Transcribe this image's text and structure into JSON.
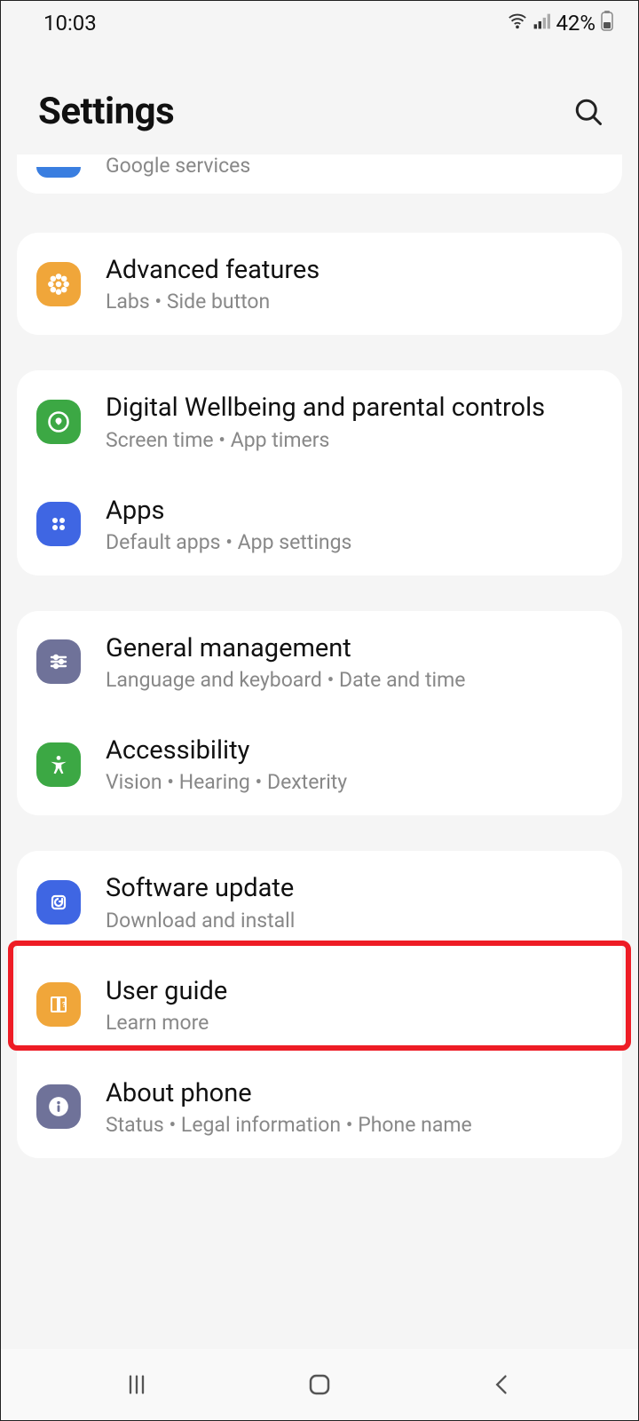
{
  "status": {
    "time": "10:03",
    "battery_text": "42%"
  },
  "header": {
    "title": "Settings"
  },
  "partial": {
    "sub": "Google services"
  },
  "g1": {
    "advanced": {
      "title": "Advanced features",
      "sub": "Labs  •  Side button",
      "color": "#f0a63a"
    }
  },
  "g2": {
    "dw": {
      "title": "Digital Wellbeing and parental controls",
      "sub": "Screen time  •  App timers",
      "color": "#3ca844"
    },
    "apps": {
      "title": "Apps",
      "sub": "Default apps  •  App settings",
      "color": "#3f66e3"
    }
  },
  "g3": {
    "gm": {
      "title": "General management",
      "sub": "Language and keyboard  •  Date and time",
      "color": "#6f7299"
    },
    "ax": {
      "title": "Accessibility",
      "sub": "Vision  •  Hearing  •  Dexterity",
      "color": "#3ca844"
    }
  },
  "g4": {
    "sw": {
      "title": "Software update",
      "sub": "Download and install",
      "color": "#3f66e3"
    },
    "guide": {
      "title": "User guide",
      "sub": "Learn more",
      "color": "#f0a63a"
    },
    "about": {
      "title": "About phone",
      "sub": "Status  •  Legal information  •  Phone name",
      "color": "#6f7299"
    }
  }
}
